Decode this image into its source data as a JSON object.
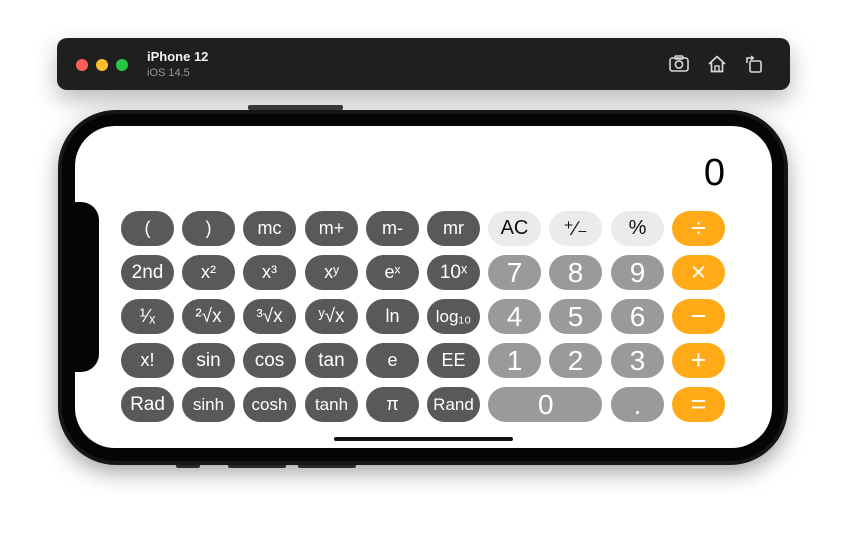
{
  "simulator": {
    "device_name": "iPhone 12",
    "os_version": "iOS 14.5",
    "toolbar_icons": [
      "screenshot-icon",
      "home-icon",
      "rotate-icon"
    ]
  },
  "calculator": {
    "display_value": "0",
    "rows": [
      [
        {
          "label": "(",
          "kind": "scientific"
        },
        {
          "label": ")",
          "kind": "scientific"
        },
        {
          "label": "mc",
          "kind": "scientific"
        },
        {
          "label": "m+",
          "kind": "scientific"
        },
        {
          "label": "m-",
          "kind": "scientific"
        },
        {
          "label": "mr",
          "kind": "scientific"
        },
        {
          "label": "AC",
          "kind": "function"
        },
        {
          "label": "⁺∕₋",
          "kind": "function"
        },
        {
          "label": "%",
          "kind": "function"
        },
        {
          "label": "÷",
          "kind": "operator"
        }
      ],
      [
        {
          "label": "2nd",
          "kind": "scientific"
        },
        {
          "label": "x²",
          "kind": "scientific"
        },
        {
          "label": "x³",
          "kind": "scientific"
        },
        {
          "label": "xʸ",
          "kind": "scientific"
        },
        {
          "label": "eˣ",
          "kind": "scientific"
        },
        {
          "label": "10ˣ",
          "kind": "scientific"
        },
        {
          "label": "7",
          "kind": "number"
        },
        {
          "label": "8",
          "kind": "number"
        },
        {
          "label": "9",
          "kind": "number"
        },
        {
          "label": "×",
          "kind": "operator"
        }
      ],
      [
        {
          "label": "¹∕ₓ",
          "kind": "scientific"
        },
        {
          "label": "²√x",
          "kind": "scientific"
        },
        {
          "label": "³√x",
          "kind": "scientific"
        },
        {
          "label": "ʸ√x",
          "kind": "scientific"
        },
        {
          "label": "ln",
          "kind": "scientific"
        },
        {
          "label": "log₁₀",
          "kind": "scientific"
        },
        {
          "label": "4",
          "kind": "number"
        },
        {
          "label": "5",
          "kind": "number"
        },
        {
          "label": "6",
          "kind": "number"
        },
        {
          "label": "−",
          "kind": "operator"
        }
      ],
      [
        {
          "label": "x!",
          "kind": "scientific"
        },
        {
          "label": "sin",
          "kind": "scientific"
        },
        {
          "label": "cos",
          "kind": "scientific"
        },
        {
          "label": "tan",
          "kind": "scientific"
        },
        {
          "label": "e",
          "kind": "scientific"
        },
        {
          "label": "EE",
          "kind": "scientific"
        },
        {
          "label": "1",
          "kind": "number"
        },
        {
          "label": "2",
          "kind": "number"
        },
        {
          "label": "3",
          "kind": "number"
        },
        {
          "label": "+",
          "kind": "operator"
        }
      ],
      [
        {
          "label": "Rad",
          "kind": "scientific"
        },
        {
          "label": "sinh",
          "kind": "scientific"
        },
        {
          "label": "cosh",
          "kind": "scientific"
        },
        {
          "label": "tanh",
          "kind": "scientific"
        },
        {
          "label": "π",
          "kind": "scientific"
        },
        {
          "label": "Rand",
          "kind": "scientific"
        },
        {
          "label": "0",
          "kind": "number"
        },
        {
          "label": ".",
          "kind": "number"
        },
        {
          "label": "=",
          "kind": "operator"
        }
      ]
    ]
  }
}
